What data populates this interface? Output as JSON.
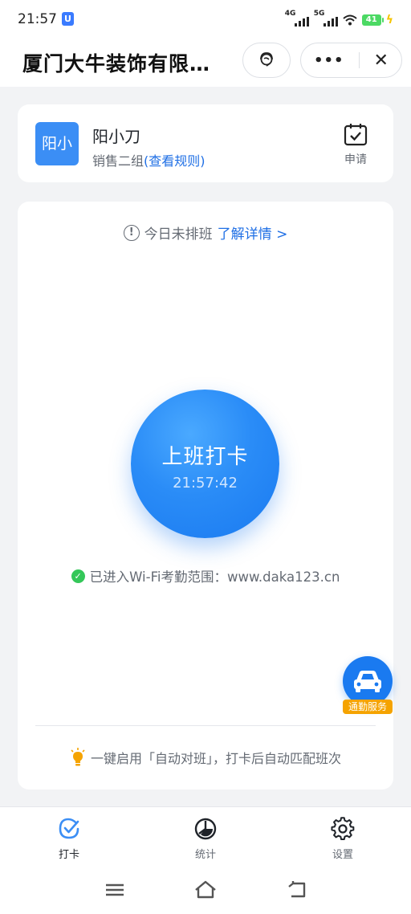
{
  "status_bar": {
    "time": "21:57",
    "app_badge": "U",
    "network_1": "4G",
    "network_2": "5G",
    "battery": "41"
  },
  "nav": {
    "title": "厦门大牛装饰有限…",
    "service_icon": "headset-icon",
    "more_icon": "more-dots-icon",
    "close_icon": "close-icon"
  },
  "user": {
    "avatar_text": "阳小",
    "name": "阳小刀",
    "group": "销售二组",
    "rules_link": "(查看规则)",
    "apply_label": "申请"
  },
  "main": {
    "notice_text": "今日未排班",
    "notice_link": "了解详情 >",
    "punch_label": "上班打卡",
    "punch_time": "21:57:42",
    "wifi_text": "已进入Wi-Fi考勤范围：www.daka123.cn",
    "commute_label": "通勤服务",
    "tip_text": "一键启用「自动对班」，打卡后自动匹配班次"
  },
  "tabs": [
    {
      "label": "打卡",
      "icon": "check-icon",
      "active": true
    },
    {
      "label": "统计",
      "icon": "pie-chart-icon",
      "active": false
    },
    {
      "label": "设置",
      "icon": "gear-icon",
      "active": false
    }
  ],
  "colors": {
    "accent": "#1f6fe5",
    "punch_button": "#2a8cf7",
    "success": "#34c759",
    "commute_tag": "#f5a300"
  }
}
